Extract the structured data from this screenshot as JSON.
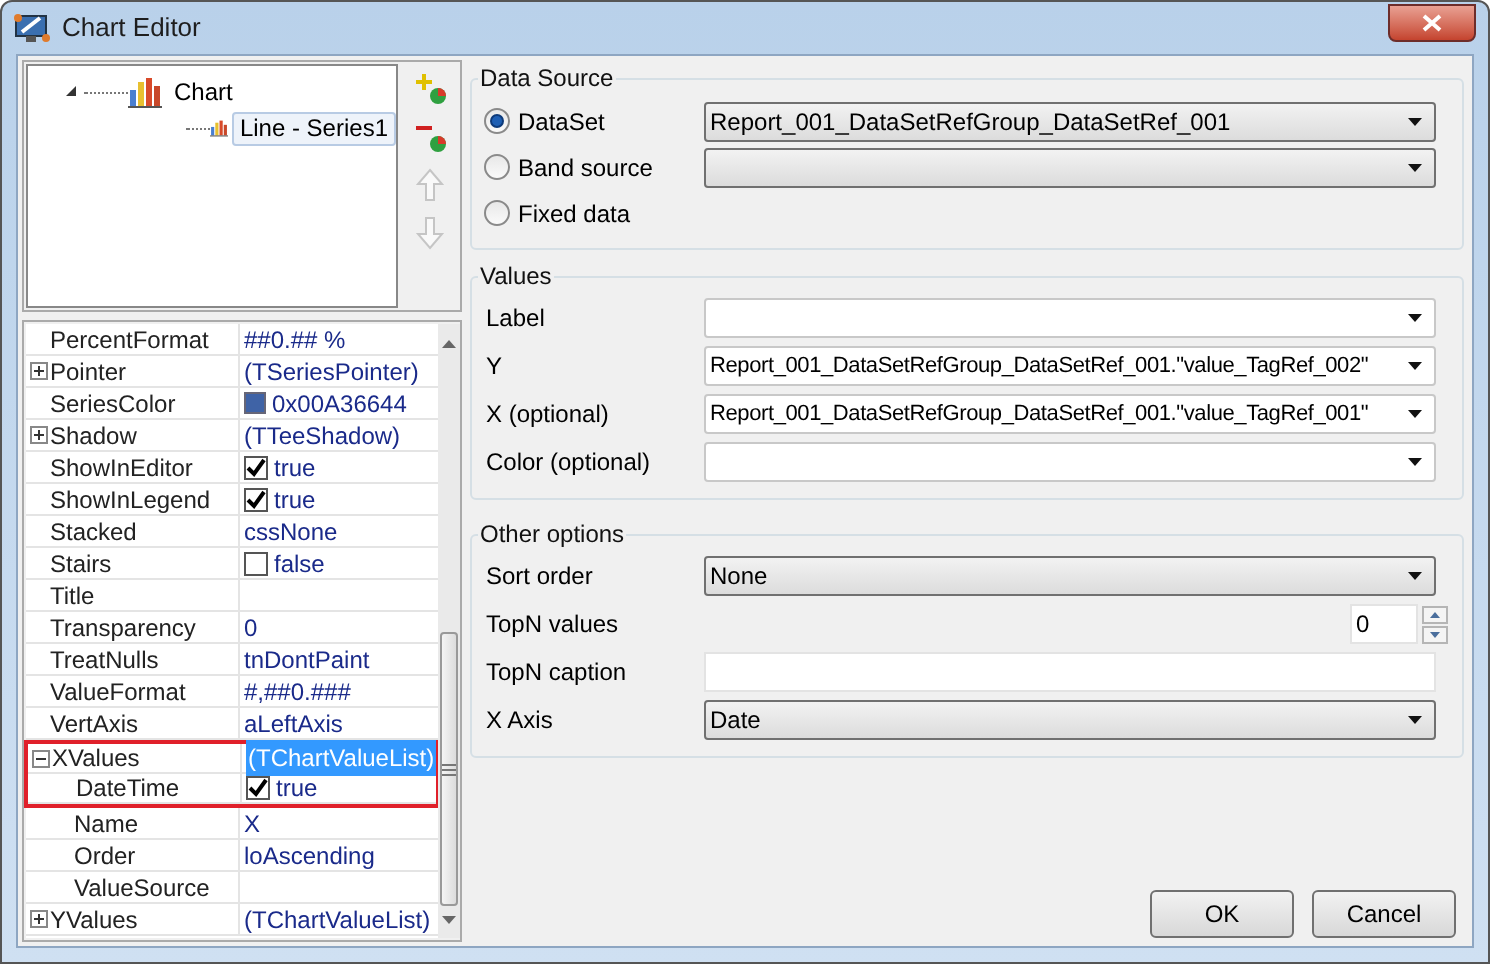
{
  "window": {
    "title": "Chart Editor"
  },
  "tree": [
    {
      "label": "Chart",
      "expanded": true,
      "selected": false,
      "children": [
        {
          "label": "Line - Series1",
          "selected": true
        }
      ]
    }
  ],
  "tree_tools": [
    {
      "kind": "add",
      "disabled": false
    },
    {
      "kind": "remove",
      "disabled": false
    },
    {
      "kind": "up",
      "disabled": true
    },
    {
      "kind": "down",
      "disabled": true
    }
  ],
  "properties": [
    {
      "name": "PercentFormat",
      "value": "##0.## %",
      "kind": "text"
    },
    {
      "name": "Pointer",
      "value": "(TSeriesPointer)",
      "kind": "group",
      "expanded": false
    },
    {
      "name": "SeriesColor",
      "value": "0x00A36644",
      "kind": "color",
      "color": "#3f63a6"
    },
    {
      "name": "Shadow",
      "value": "(TTeeShadow)",
      "kind": "group",
      "expanded": false
    },
    {
      "name": "ShowInEditor",
      "value": "true",
      "kind": "check",
      "checked": true
    },
    {
      "name": "ShowInLegend",
      "value": "true",
      "kind": "check",
      "checked": true
    },
    {
      "name": "Stacked",
      "value": "cssNone",
      "kind": "text"
    },
    {
      "name": "Stairs",
      "value": "false",
      "kind": "check",
      "checked": false
    },
    {
      "name": "Title",
      "kind": "text"
    },
    {
      "name": "Transparency",
      "value": "0",
      "kind": "text"
    },
    {
      "name": "TreatNulls",
      "value": "tnDontPaint",
      "kind": "text"
    },
    {
      "name": "ValueFormat",
      "value": "#,##0.###",
      "kind": "text"
    },
    {
      "name": "VertAxis",
      "value": "aLeftAxis",
      "kind": "text"
    },
    {
      "name": "XValues",
      "value": "(TChartValueList)",
      "kind": "group",
      "expanded": true,
      "selected": true,
      "outlined": true,
      "children": [
        {
          "name": "DateTime",
          "value": "true",
          "kind": "check",
          "checked": true,
          "outlined": true
        },
        {
          "name": "Name",
          "value": "X",
          "kind": "text"
        },
        {
          "name": "Order",
          "value": "loAscending",
          "kind": "text"
        },
        {
          "name": "ValueSource",
          "kind": "text"
        }
      ]
    },
    {
      "name": "YValues",
      "value": "(TChartValueList)",
      "kind": "group",
      "expanded": false
    }
  ],
  "data_source": {
    "title": "Data Source",
    "options": [
      {
        "label": "DataSet",
        "selected": true,
        "kind": "dropdown",
        "value": "Report_001_DataSetRefGroup_DataSetRef_001"
      },
      {
        "label": "Band source",
        "selected": false,
        "kind": "dropdown"
      },
      {
        "label": "Fixed data",
        "selected": false,
        "kind": "plain"
      }
    ]
  },
  "values": {
    "title": "Values",
    "fields": [
      {
        "label": "Label"
      },
      {
        "label": "Y",
        "value": "Report_001_DataSetRefGroup_DataSetRef_001.\"value_TagRef_002\""
      },
      {
        "label": "X (optional)",
        "value": "Report_001_DataSetRefGroup_DataSetRef_001.\"value_TagRef_001\""
      },
      {
        "label": "Color (optional)"
      }
    ]
  },
  "other_options": {
    "title": "Other options",
    "fields": [
      {
        "label": "Sort order",
        "kind": "dropdown",
        "value": "None"
      },
      {
        "label": "TopN values",
        "kind": "spinner",
        "value": "0"
      },
      {
        "label": "TopN caption",
        "kind": "text"
      },
      {
        "label": "X Axis",
        "kind": "dropdown",
        "value": "Date"
      }
    ]
  },
  "buttons": [
    "OK",
    "Cancel"
  ]
}
